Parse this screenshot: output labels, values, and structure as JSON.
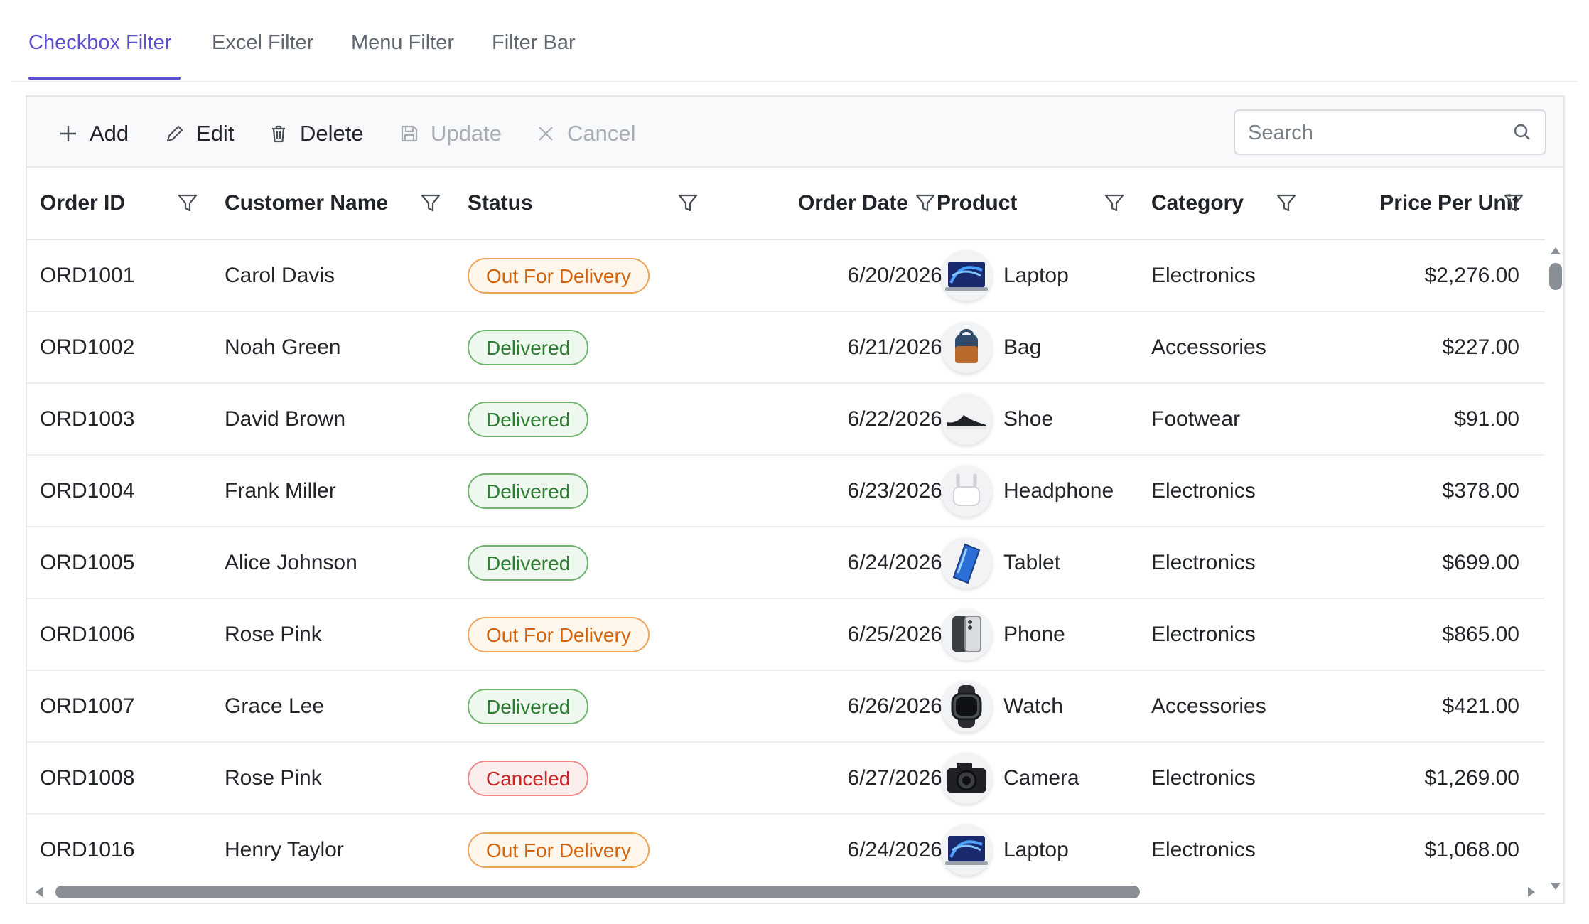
{
  "tabs": [
    "Checkbox Filter",
    "Excel Filter",
    "Menu Filter",
    "Filter Bar"
  ],
  "toolbar": {
    "add": "Add",
    "edit": "Edit",
    "delete": "Delete",
    "update": "Update",
    "cancel": "Cancel",
    "search_placeholder": "Search"
  },
  "columns": [
    "Order ID",
    "Customer Name",
    "Status",
    "Order Date",
    "Product",
    "Category",
    "Price Per Unit"
  ],
  "rows": [
    {
      "id": "ORD1001",
      "customer": "Carol Davis",
      "status": "Out For Delivery",
      "date": "6/20/2026",
      "product": "Laptop",
      "image": "laptop-image",
      "category": "Electronics",
      "price": "$2,276.00"
    },
    {
      "id": "ORD1002",
      "customer": "Noah Green",
      "status": "Delivered",
      "date": "6/21/2026",
      "product": "Bag",
      "image": "bag-image",
      "category": "Accessories",
      "price": "$227.00"
    },
    {
      "id": "ORD1003",
      "customer": "David Brown",
      "status": "Delivered",
      "date": "6/22/2026",
      "product": "Shoe",
      "image": "shoe-image",
      "category": "Footwear",
      "price": "$91.00"
    },
    {
      "id": "ORD1004",
      "customer": "Frank Miller",
      "status": "Delivered",
      "date": "6/23/2026",
      "product": "Headphone",
      "image": "headphone-image",
      "category": "Electronics",
      "price": "$378.00"
    },
    {
      "id": "ORD1005",
      "customer": "Alice Johnson",
      "status": "Delivered",
      "date": "6/24/2026",
      "product": "Tablet",
      "image": "tablet-image",
      "category": "Electronics",
      "price": "$699.00"
    },
    {
      "id": "ORD1006",
      "customer": "Rose Pink",
      "status": "Out For Delivery",
      "date": "6/25/2026",
      "product": "Phone",
      "image": "phone-image",
      "category": "Electronics",
      "price": "$865.00"
    },
    {
      "id": "ORD1007",
      "customer": "Grace Lee",
      "status": "Delivered",
      "date": "6/26/2026",
      "product": "Watch",
      "image": "watch-image",
      "category": "Accessories",
      "price": "$421.00"
    },
    {
      "id": "ORD1008",
      "customer": "Rose Pink",
      "status": "Canceled",
      "date": "6/27/2026",
      "product": "Camera",
      "image": "camera-image",
      "category": "Electronics",
      "price": "$1,269.00"
    },
    {
      "id": "ORD1016",
      "customer": "Henry Taylor",
      "status": "Out For Delivery",
      "date": "6/24/2026",
      "product": "Laptop",
      "image": "laptop-image",
      "category": "Electronics",
      "price": "$1,068.00"
    }
  ],
  "colors": {
    "accent": "#5b4fd0",
    "out_for_delivery": "#d2640e",
    "delivered": "#2e7d32",
    "canceled": "#c62828"
  }
}
